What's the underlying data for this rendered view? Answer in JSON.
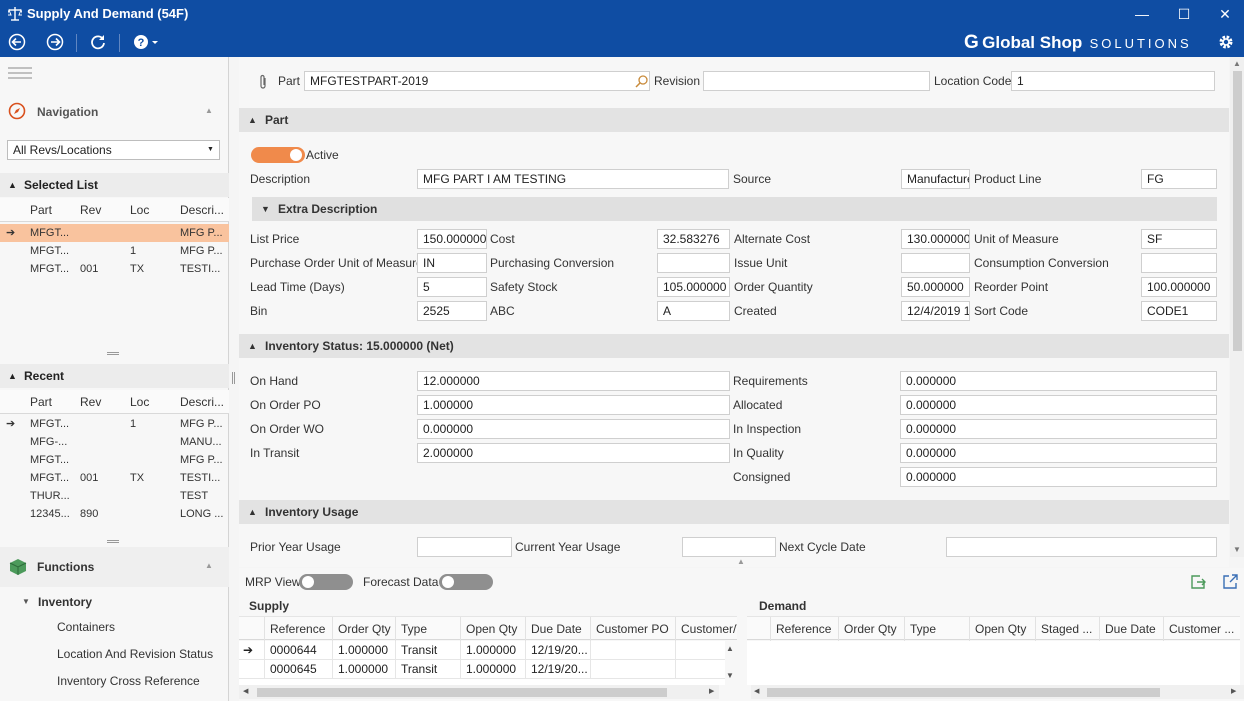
{
  "window": {
    "title": "Supply And Demand (54F)",
    "minimize_glyph": "—",
    "maximize_glyph": "☐",
    "close_glyph": "✕"
  },
  "brand": {
    "name": "Global Shop",
    "suffix": "SOLUTIONS",
    "logo_letter": "G"
  },
  "colors": {
    "title_bar": "#0f4da3",
    "accent_orange": "#f08a4b",
    "selected_row": "#f9c39e",
    "arrow_green": "#5a9e2a"
  },
  "icons": {
    "back": "arrow-left-circle-icon",
    "forward": "arrow-right-circle-icon",
    "refresh": "refresh-icon",
    "help": "help-icon",
    "settings": "gear-icon",
    "attach": "paperclip-icon",
    "search": "magnifier-icon",
    "export": "export-icon",
    "popout": "popout-icon"
  },
  "sidebar": {
    "navigation_label": "Navigation",
    "rev_filter": "All Revs/Locations",
    "selected_list": {
      "title": "Selected List",
      "columns": [
        "Part",
        "Rev",
        "Loc",
        "Descri..."
      ],
      "rows": [
        {
          "part": "MFGT...",
          "rev": "",
          "loc": "",
          "desc": "MFG P...",
          "selected": true
        },
        {
          "part": "MFGT...",
          "rev": "",
          "loc": "1",
          "desc": "MFG P..."
        },
        {
          "part": "MFGT...",
          "rev": "001",
          "loc": "TX",
          "desc": "TESTI..."
        }
      ]
    },
    "recent": {
      "title": "Recent",
      "columns": [
        "Part",
        "Rev",
        "Loc",
        "Descri..."
      ],
      "rows": [
        {
          "part": "MFGT...",
          "rev": "",
          "loc": "1",
          "desc": "MFG P..."
        },
        {
          "part": "MFG-...",
          "rev": "",
          "loc": "",
          "desc": "MANU..."
        },
        {
          "part": "MFGT...",
          "rev": "",
          "loc": "",
          "desc": "MFG P..."
        },
        {
          "part": "MFGT...",
          "rev": "001",
          "loc": "TX",
          "desc": "TESTI..."
        },
        {
          "part": "THUR...",
          "rev": "",
          "loc": "",
          "desc": "TEST"
        },
        {
          "part": "12345...",
          "rev": "890",
          "loc": "",
          "desc": "LONG ..."
        }
      ]
    },
    "functions": {
      "title": "Functions",
      "group": "Inventory",
      "items": [
        "Containers",
        "Location And Revision Status",
        "Inventory Cross Reference"
      ]
    }
  },
  "header": {
    "part_label": "Part",
    "part_value": "MFGTESTPART-2019",
    "revision_label": "Revision",
    "revision_value": "",
    "location_label": "Location Code",
    "location_value": "1"
  },
  "part_section": {
    "title": "Part",
    "active_label": "Active",
    "description_label": "Description",
    "description_value": "MFG PART I AM TESTING",
    "source_label": "Source",
    "source_value": "Manufacture",
    "product_line_label": "Product Line",
    "product_line_value": "FG",
    "extra_description_title": "Extra Description",
    "fields": {
      "list_price": {
        "label": "List Price",
        "value": "150.000000"
      },
      "cost": {
        "label": "Cost",
        "value": "32.583276"
      },
      "alternate_cost": {
        "label": "Alternate Cost",
        "value": "130.000000"
      },
      "unit_of_measure": {
        "label": "Unit of Measure",
        "value": "SF"
      },
      "po_uom": {
        "label": "Purchase Order Unit of Measure",
        "value": "IN"
      },
      "purchasing_conversion": {
        "label": "Purchasing Conversion",
        "value": ""
      },
      "issue_unit": {
        "label": "Issue Unit",
        "value": ""
      },
      "consumption_conversion": {
        "label": "Consumption Conversion",
        "value": ""
      },
      "lead_time": {
        "label": "Lead Time (Days)",
        "value": "5"
      },
      "safety_stock": {
        "label": "Safety Stock",
        "value": "105.000000"
      },
      "order_quantity": {
        "label": "Order Quantity",
        "value": "50.000000"
      },
      "reorder_point": {
        "label": "Reorder Point",
        "value": "100.000000"
      },
      "bin": {
        "label": "Bin",
        "value": "2525"
      },
      "abc": {
        "label": "ABC",
        "value": "A"
      },
      "created": {
        "label": "Created",
        "value": "12/4/2019 1"
      },
      "sort_code": {
        "label": "Sort Code",
        "value": "CODE1"
      }
    }
  },
  "inventory_status": {
    "title": "Inventory Status: 15.000000 (Net)",
    "left": [
      {
        "label": "On Hand",
        "value": "12.000000"
      },
      {
        "label": "On Order PO",
        "value": "1.000000"
      },
      {
        "label": "On Order WO",
        "value": "0.000000"
      },
      {
        "label": "In Transit",
        "value": "2.000000"
      }
    ],
    "right": [
      {
        "label": "Requirements",
        "value": "0.000000"
      },
      {
        "label": "Allocated",
        "value": "0.000000"
      },
      {
        "label": "In Inspection",
        "value": "0.000000"
      },
      {
        "label": "In Quality",
        "value": "0.000000"
      },
      {
        "label": "Consigned",
        "value": "0.000000"
      }
    ]
  },
  "inventory_usage": {
    "title": "Inventory Usage",
    "prior_label": "Prior Year Usage",
    "prior_value": "",
    "current_label": "Current Year Usage",
    "current_value": "",
    "next_cycle_label": "Next Cycle Date",
    "next_cycle_value": ""
  },
  "bottom": {
    "mrp_label": "MRP View",
    "forecast_label": "Forecast Data",
    "supply": {
      "title": "Supply",
      "columns": [
        "Reference",
        "Order Qty",
        "Type",
        "Open Qty",
        "Due Date",
        "Customer PO",
        "Customer/Ve"
      ],
      "rows": [
        [
          "0000644",
          "1.000000",
          "Transit",
          "1.000000",
          "12/19/20...",
          "",
          ""
        ],
        [
          "0000645",
          "1.000000",
          "Transit",
          "1.000000",
          "12/19/20...",
          "",
          ""
        ]
      ]
    },
    "demand": {
      "title": "Demand",
      "columns": [
        "Reference",
        "Order Qty",
        "Type",
        "Open Qty",
        "Staged ...",
        "Due Date",
        "Customer ..."
      ],
      "rows": []
    }
  }
}
